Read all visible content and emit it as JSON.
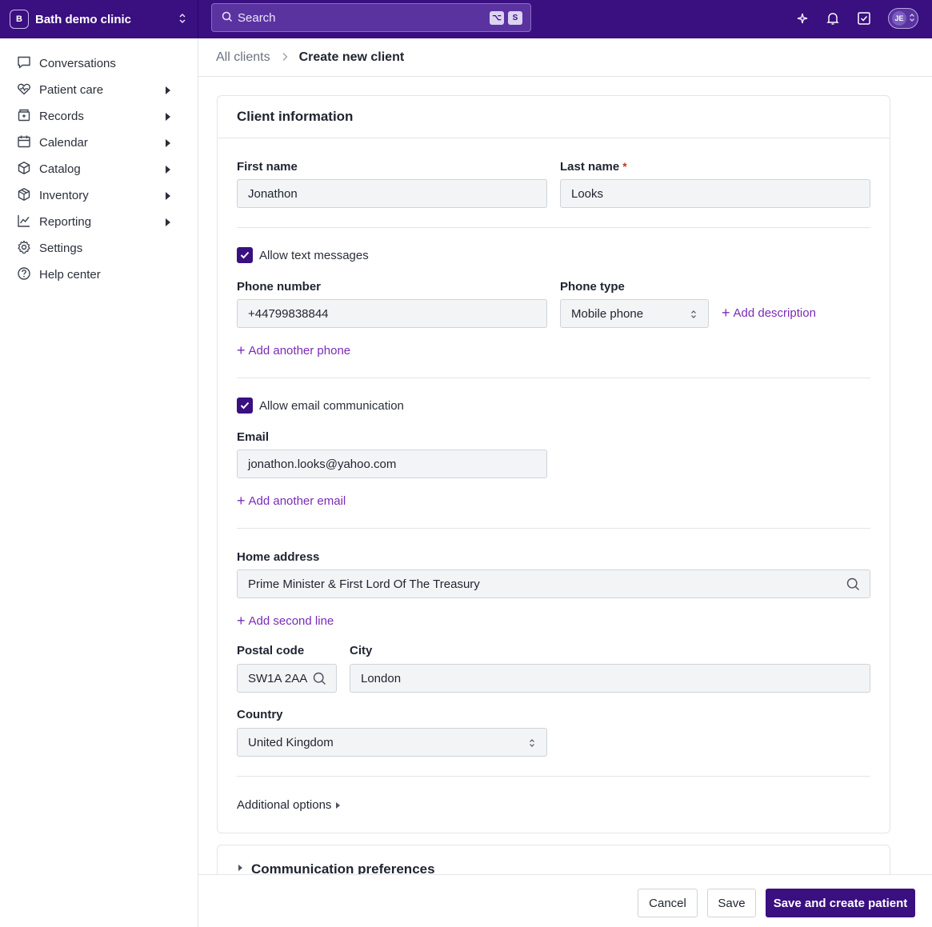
{
  "clinic": {
    "badge": "B",
    "name": "Bath demo clinic"
  },
  "search": {
    "placeholder": "Search",
    "shortcut_key1": "⌥",
    "shortcut_key2": "S"
  },
  "user": {
    "initials": "JE"
  },
  "sidebar": {
    "items": [
      {
        "label": "Conversations",
        "icon": "chat-bubble-icon",
        "expandable": false
      },
      {
        "label": "Patient care",
        "icon": "heart-pulse-icon",
        "expandable": true
      },
      {
        "label": "Records",
        "icon": "records-icon",
        "expandable": true
      },
      {
        "label": "Calendar",
        "icon": "calendar-icon",
        "expandable": true
      },
      {
        "label": "Catalog",
        "icon": "box-icon",
        "expandable": true
      },
      {
        "label": "Inventory",
        "icon": "package-icon",
        "expandable": true
      },
      {
        "label": "Reporting",
        "icon": "chart-line-icon",
        "expandable": true
      },
      {
        "label": "Settings",
        "icon": "gear-icon",
        "expandable": false
      },
      {
        "label": "Help center",
        "icon": "help-circle-icon",
        "expandable": false
      }
    ]
  },
  "breadcrumb": {
    "parent": "All clients",
    "current": "Create new client"
  },
  "client_info": {
    "title": "Client information",
    "first_name": {
      "label": "First name",
      "value": "Jonathon"
    },
    "last_name": {
      "label": "Last name",
      "required_mark": "*",
      "value": "Looks"
    },
    "allow_text": "Allow text messages",
    "phone_number": {
      "label": "Phone number",
      "value": "+44799838844"
    },
    "phone_type": {
      "label": "Phone type",
      "value": "Mobile phone"
    },
    "add_description": "Add description",
    "add_another_phone": "Add another phone",
    "allow_email": "Allow email communication",
    "email": {
      "label": "Email",
      "value": "jonathon.looks@yahoo.com"
    },
    "add_another_email": "Add another email",
    "home_address": {
      "label": "Home address",
      "value": "Prime Minister & First Lord Of The Treasury"
    },
    "add_second_line": "Add second line",
    "postal_code": {
      "label": "Postal code",
      "value": "SW1A 2AA"
    },
    "city": {
      "label": "City",
      "value": "London"
    },
    "country": {
      "label": "Country",
      "value": "United Kingdom"
    },
    "additional_options": "Additional options"
  },
  "communication": {
    "title": "Communication preferences"
  },
  "footer": {
    "cancel": "Cancel",
    "save": "Save",
    "save_create": "Save and create patient"
  },
  "colors": {
    "brand": "#3a0f80",
    "link": "#7a2bb7",
    "required": "#c0392b"
  }
}
